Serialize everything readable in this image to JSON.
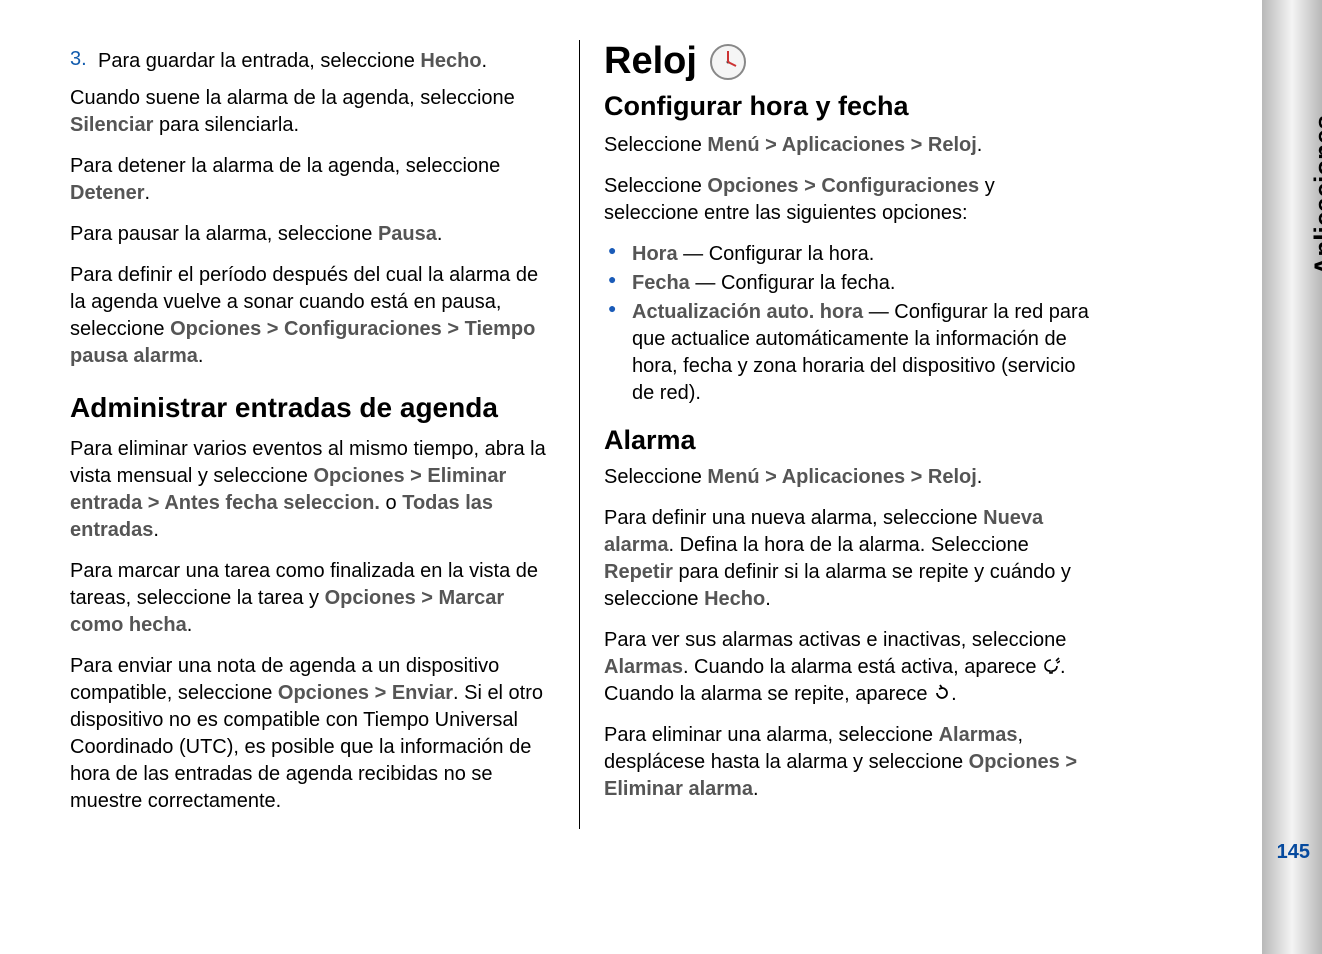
{
  "sidebar": {
    "label": "Aplicaciones",
    "page_num": "145"
  },
  "left": {
    "step3": {
      "num": "3.",
      "pre": "Para guardar la entrada, seleccione ",
      "b": "Hecho",
      "post": "."
    },
    "p1": {
      "t1": "Cuando suene la alarma de la agenda, seleccione ",
      "b1": "Silenciar",
      "t2": " para silenciarla."
    },
    "p2": {
      "t1": "Para detener la alarma de la agenda, seleccione ",
      "b1": "Detener",
      "t2": "."
    },
    "p3": {
      "t1": "Para pausar la alarma, seleccione ",
      "b1": "Pausa",
      "t2": "."
    },
    "p4": {
      "t1": "Para definir el período después del cual la alarma de la agenda vuelve a sonar cuando está en pausa, seleccione ",
      "b1": "Opciones",
      "s1": " > ",
      "b2": "Configuraciones",
      "s2": " > ",
      "b3": "Tiempo pausa alarma",
      "t2": "."
    },
    "h2": "Administrar entradas de agenda",
    "p5": {
      "t1": "Para eliminar varios eventos al mismo tiempo, abra la vista mensual y seleccione ",
      "b1": "Opciones",
      "s1": " > ",
      "b2": "Eliminar entrada",
      "s2": " > ",
      "b3": "Antes fecha seleccion.",
      "t2": " o ",
      "b4": "Todas las entradas",
      "t3": "."
    },
    "p6": {
      "t1": "Para marcar una tarea como finalizada en la vista de tareas, seleccione la tarea y ",
      "b1": "Opciones",
      "s1": " > ",
      "b2": "Marcar como hecha",
      "t2": "."
    },
    "p7": {
      "t1": "Para enviar una nota de agenda a un dispositivo compatible, seleccione ",
      "b1": "Opciones",
      "s1": " > ",
      "b2": "Enviar",
      "t2": ". Si el otro dispositivo no es compatible con Tiempo Universal Coordinado (UTC), es posible que la información de hora de las entradas de agenda recibidas no se muestre correctamente."
    }
  },
  "right": {
    "h1": "Reloj",
    "h2a": "Configurar hora y fecha",
    "nav1": {
      "t1": "Seleccione ",
      "b1": "Menú",
      "s1": " > ",
      "b2": "Aplicaciones",
      "s2": " > ",
      "b3": "Reloj",
      "t2": "."
    },
    "p1": {
      "t1": "Seleccione ",
      "b1": "Opciones",
      "s1": " > ",
      "b2": "Configuraciones",
      "t2": " y seleccione entre las siguientes opciones:"
    },
    "li1": {
      "b": "Hora",
      "dash": "  — ",
      "t": "Configurar la hora."
    },
    "li2": {
      "b": "Fecha",
      "dash": "  — ",
      "t": "Configurar la fecha."
    },
    "li3": {
      "b": "Actualización auto. hora",
      "dash": "  — ",
      "t": "Configurar la red para que actualice automáticamente la información de hora, fecha y zona horaria del dispositivo (servicio de red)."
    },
    "h2b": "Alarma",
    "nav2": {
      "t1": "Seleccione ",
      "b1": "Menú",
      "s1": " > ",
      "b2": "Aplicaciones",
      "s2": " > ",
      "b3": "Reloj",
      "t2": "."
    },
    "p2": {
      "t1": "Para definir una nueva alarma, seleccione ",
      "b1": "Nueva alarma",
      "t2": ". Defina la hora de la alarma. Seleccione ",
      "b2": "Repetir",
      "t3": " para definir si la alarma se repite y cuándo y seleccione ",
      "b3": "Hecho",
      "t4": "."
    },
    "p3": {
      "t1": "Para ver sus alarmas activas e inactivas, seleccione ",
      "b1": "Alarmas",
      "t2": ". Cuando la alarma está activa, aparece ",
      "t3": ". Cuando la alarma se repite, aparece ",
      "t4": "."
    },
    "p4": {
      "t1": "Para eliminar una alarma, seleccione ",
      "b1": "Alarmas",
      "t2": ", desplácese hasta la alarma y seleccione ",
      "b2": "Opciones",
      "s1": " > ",
      "b3": "Eliminar alarma",
      "t3": "."
    }
  }
}
